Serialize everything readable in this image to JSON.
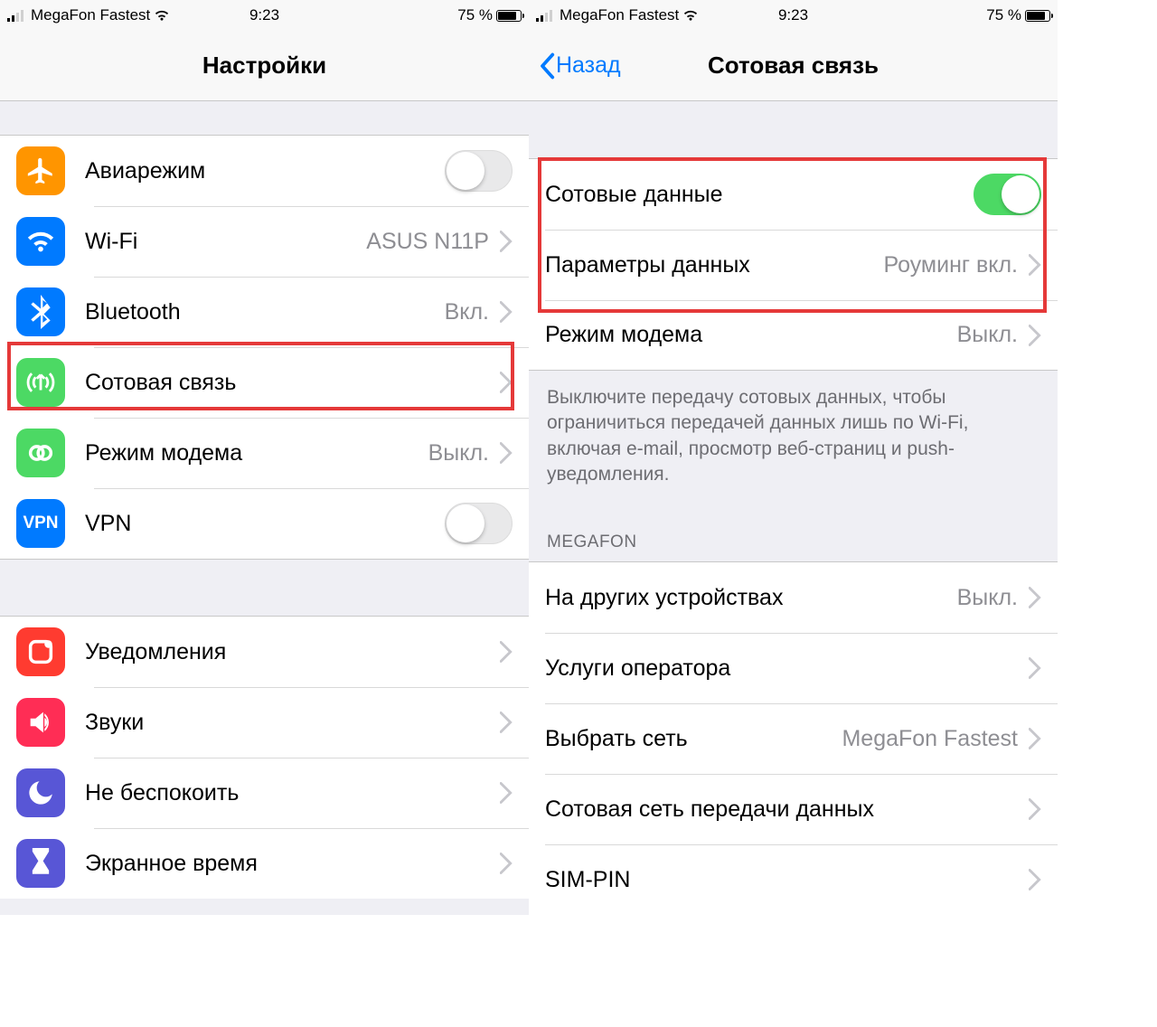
{
  "status": {
    "carrier": "MegaFon Fastest",
    "time": "9:23",
    "battery_pct": "75 %"
  },
  "left": {
    "title": "Настройки",
    "rows": {
      "airplane": "Авиарежим",
      "wifi": "Wi-Fi",
      "wifi_value": "ASUS N11P",
      "bluetooth": "Bluetooth",
      "bluetooth_value": "Вкл.",
      "cellular": "Сотовая связь",
      "hotspot": "Режим модема",
      "hotspot_value": "Выкл.",
      "vpn": "VPN",
      "notifications": "Уведомления",
      "sounds": "Звуки",
      "dnd": "Не беспокоить",
      "screentime": "Экранное время"
    }
  },
  "right": {
    "back": "Назад",
    "title": "Сотовая связь",
    "rows": {
      "cell_data": "Сотовые данные",
      "data_params": "Параметры данных",
      "data_params_value": "Роуминг вкл.",
      "hotspot": "Режим модема",
      "hotspot_value": "Выкл.",
      "note": "Выключите передачу сотовых данных, чтобы ограничиться передачей данных лишь по Wi-Fi, включая e-mail, просмотр веб-страниц и push-уведомления.",
      "section": "MEGAFON",
      "other_devices": "На других устройствах",
      "other_devices_value": "Выкл.",
      "carrier_services": "Услуги оператора",
      "select_network": "Выбрать сеть",
      "select_network_value": "MegaFon Fastest",
      "cell_network": "Сотовая сеть передачи данных",
      "simpin": "SIM-PIN"
    }
  }
}
